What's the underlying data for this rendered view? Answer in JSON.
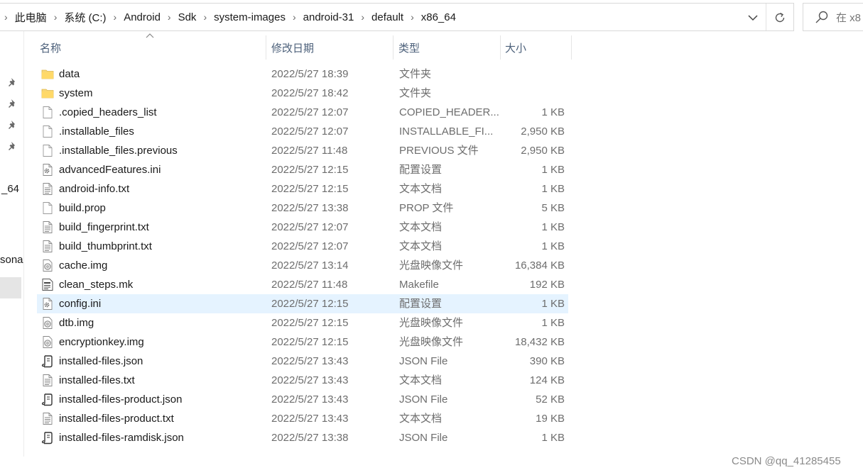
{
  "breadcrumb": [
    "此电脑",
    "系统 (C:)",
    "Android",
    "Sdk",
    "system-images",
    "android-31",
    "default",
    "x86_64"
  ],
  "search": {
    "placeholder": "在 x8"
  },
  "nav": {
    "labels": [
      "_64",
      "sona"
    ]
  },
  "columns": {
    "name": "名称",
    "date": "修改日期",
    "type": "类型",
    "size": "大小"
  },
  "files": [
    {
      "name": "data",
      "date": "2022/5/27 18:39",
      "type": "文件夹",
      "size": "",
      "icon": "folder-icon"
    },
    {
      "name": "system",
      "date": "2022/5/27 18:42",
      "type": "文件夹",
      "size": "",
      "icon": "folder-icon"
    },
    {
      "name": ".copied_headers_list",
      "date": "2022/5/27 12:07",
      "type": "COPIED_HEADER...",
      "size": "1 KB",
      "icon": "blank-file-icon"
    },
    {
      "name": ".installable_files",
      "date": "2022/5/27 12:07",
      "type": "INSTALLABLE_FI...",
      "size": "2,950 KB",
      "icon": "blank-file-icon"
    },
    {
      "name": ".installable_files.previous",
      "date": "2022/5/27 11:48",
      "type": "PREVIOUS 文件",
      "size": "2,950 KB",
      "icon": "blank-file-icon"
    },
    {
      "name": "advancedFeatures.ini",
      "date": "2022/5/27 12:15",
      "type": "配置设置",
      "size": "1 KB",
      "icon": "config-file-icon"
    },
    {
      "name": "android-info.txt",
      "date": "2022/5/27 12:15",
      "type": "文本文档",
      "size": "1 KB",
      "icon": "text-file-icon"
    },
    {
      "name": "build.prop",
      "date": "2022/5/27 13:38",
      "type": "PROP 文件",
      "size": "5 KB",
      "icon": "blank-file-icon"
    },
    {
      "name": "build_fingerprint.txt",
      "date": "2022/5/27 12:07",
      "type": "文本文档",
      "size": "1 KB",
      "icon": "text-file-icon"
    },
    {
      "name": "build_thumbprint.txt",
      "date": "2022/5/27 12:07",
      "type": "文本文档",
      "size": "1 KB",
      "icon": "text-file-icon"
    },
    {
      "name": "cache.img",
      "date": "2022/5/27 13:14",
      "type": "光盘映像文件",
      "size": "16,384 KB",
      "icon": "disc-image-icon"
    },
    {
      "name": "clean_steps.mk",
      "date": "2022/5/27 11:48",
      "type": "Makefile",
      "size": "192 KB",
      "icon": "makefile-icon"
    },
    {
      "name": "config.ini",
      "date": "2022/5/27 12:15",
      "type": "配置设置",
      "size": "1 KB",
      "icon": "config-file-icon",
      "selected": true
    },
    {
      "name": "dtb.img",
      "date": "2022/5/27 12:15",
      "type": "光盘映像文件",
      "size": "1 KB",
      "icon": "disc-image-icon"
    },
    {
      "name": "encryptionkey.img",
      "date": "2022/5/27 12:15",
      "type": "光盘映像文件",
      "size": "18,432 KB",
      "icon": "disc-image-icon"
    },
    {
      "name": "installed-files.json",
      "date": "2022/5/27 13:43",
      "type": "JSON File",
      "size": "390 KB",
      "icon": "json-file-icon"
    },
    {
      "name": "installed-files.txt",
      "date": "2022/5/27 13:43",
      "type": "文本文档",
      "size": "124 KB",
      "icon": "text-file-icon"
    },
    {
      "name": "installed-files-product.json",
      "date": "2022/5/27 13:43",
      "type": "JSON File",
      "size": "52 KB",
      "icon": "json-file-icon"
    },
    {
      "name": "installed-files-product.txt",
      "date": "2022/5/27 13:43",
      "type": "文本文档",
      "size": "19 KB",
      "icon": "text-file-icon"
    },
    {
      "name": "installed-files-ramdisk.json",
      "date": "2022/5/27 13:38",
      "type": "JSON File",
      "size": "1 KB",
      "icon": "json-file-icon"
    }
  ],
  "watermark": "CSDN @qq_41285455",
  "colors": {
    "selection": "#e5f3ff",
    "header_text": "#4c607a",
    "folder": "#f8d775"
  }
}
